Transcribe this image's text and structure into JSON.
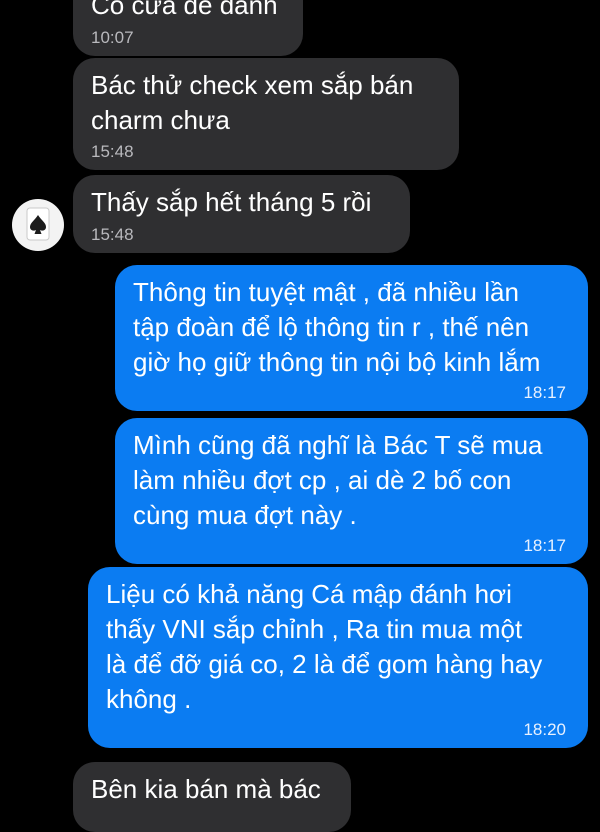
{
  "messages": [
    {
      "side": "in",
      "text": "Có cửa để đánh",
      "time": "10:07"
    },
    {
      "side": "in",
      "text": "Bác thử check xem sắp bán\ncharm chưa",
      "time": "15:48"
    },
    {
      "side": "in",
      "text": "Thấy sắp hết tháng 5 rồi",
      "time": "15:48"
    },
    {
      "side": "out",
      "text": "Thông tin tuyệt mật , đã nhiều lần\ntập đoàn để lộ thông tin r , thế nên\ngiờ họ giữ thông tin nội bộ kinh lắm",
      "time": "18:17"
    },
    {
      "side": "out",
      "text": "Mình cũng đã nghĩ là Bác T sẽ mua\nlàm nhiều đợt cp , ai dè 2 bố con\ncùng mua đợt này .",
      "time": "18:17"
    },
    {
      "side": "out",
      "text": "Liệu có khả năng Cá mập đánh hơi\nthấy VNI sắp chỉnh , Ra tin mua một\nlà để đỡ giá co, 2 là để gom hàng hay\nkhông .",
      "time": "18:20"
    },
    {
      "side": "in",
      "text": "Bên kia bán mà bác",
      "time": ""
    }
  ],
  "avatar": {
    "icon": "ace-of-spades-icon"
  },
  "colors": {
    "incoming": "#2f2f31",
    "outgoing": "#0b7cf2",
    "background": "#000000"
  }
}
